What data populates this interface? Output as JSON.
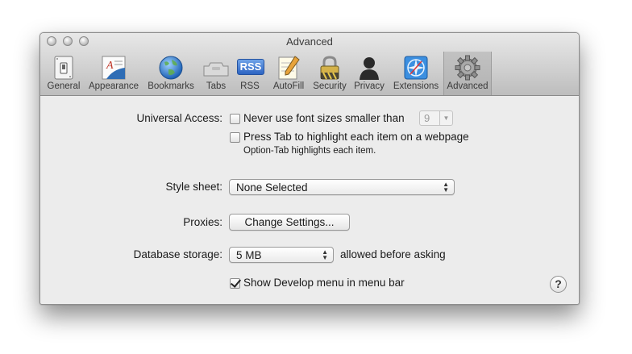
{
  "window": {
    "title": "Advanced"
  },
  "toolbar": {
    "items": [
      {
        "label": "General",
        "icon": "general-switch-icon"
      },
      {
        "label": "Appearance",
        "icon": "appearance-icon"
      },
      {
        "label": "Bookmarks",
        "icon": "globe-icon"
      },
      {
        "label": "Tabs",
        "icon": "tabs-icon"
      },
      {
        "label": "RSS",
        "icon": "rss-icon"
      },
      {
        "label": "AutoFill",
        "icon": "autofill-pencil-icon"
      },
      {
        "label": "Security",
        "icon": "lock-icon"
      },
      {
        "label": "Privacy",
        "icon": "person-silhouette-icon"
      },
      {
        "label": "Extensions",
        "icon": "extensions-compass-icon"
      },
      {
        "label": "Advanced",
        "icon": "gear-icon",
        "selected": true
      }
    ],
    "rss_badge": "RSS"
  },
  "universal_access": {
    "label": "Universal Access:",
    "min_font_checkbox": {
      "label": "Never use font sizes smaller than",
      "checked": false
    },
    "min_font_value": "9",
    "tab_checkbox": {
      "label": "Press Tab to highlight each item on a webpage",
      "checked": false
    },
    "tab_hint": "Option-Tab highlights each item."
  },
  "style_sheet": {
    "label": "Style sheet:",
    "value": "None Selected"
  },
  "proxies": {
    "label": "Proxies:",
    "button": "Change Settings..."
  },
  "database": {
    "label": "Database storage:",
    "value": "5 MB",
    "suffix": "allowed before asking"
  },
  "develop": {
    "label": "Show Develop menu in menu bar",
    "checked": true
  },
  "help": {
    "glyph": "?"
  }
}
